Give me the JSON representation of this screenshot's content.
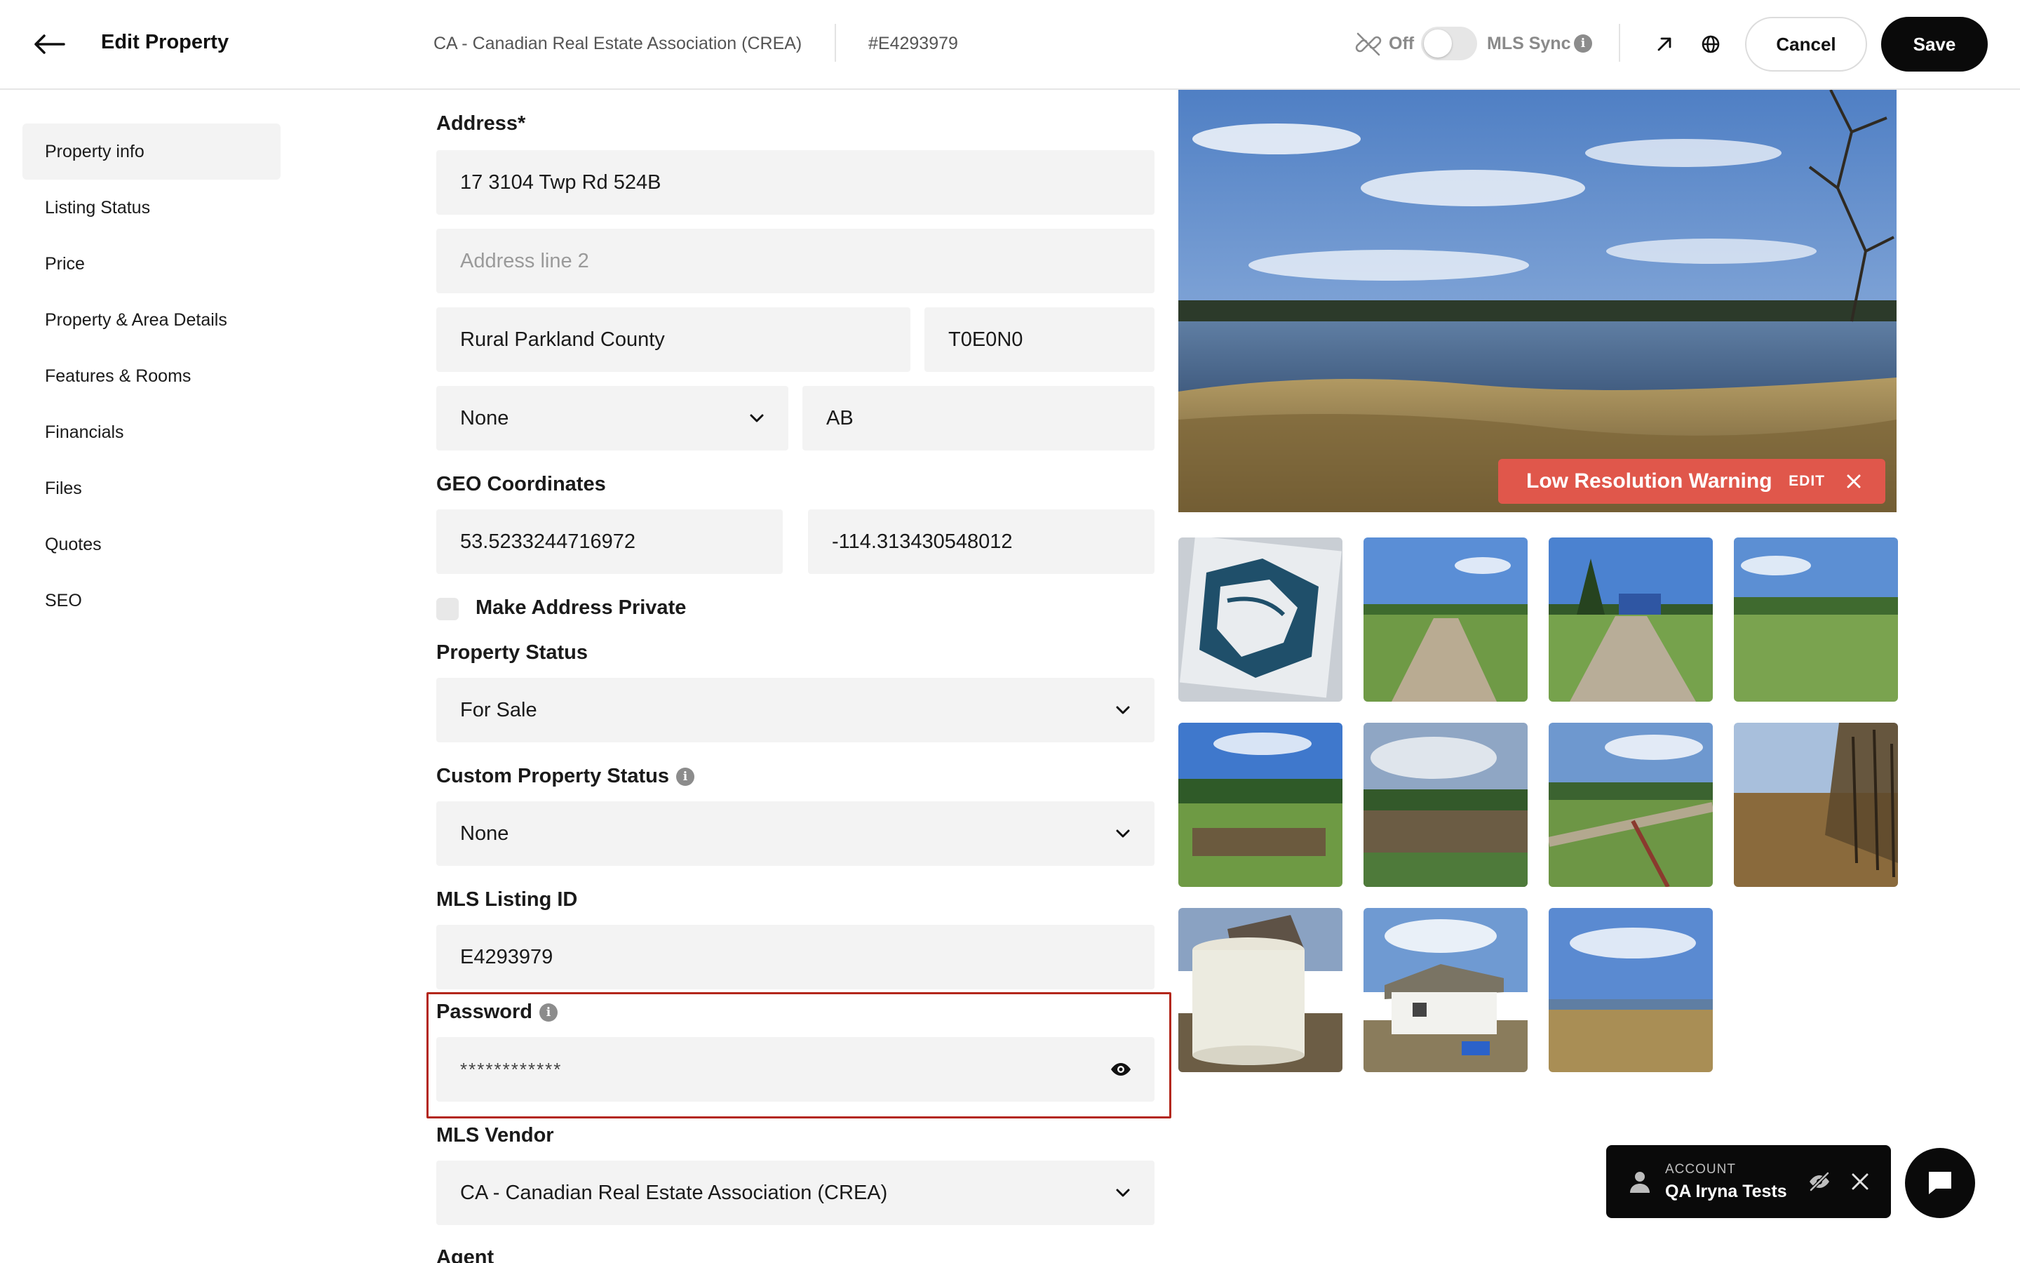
{
  "header": {
    "title": "Edit Property",
    "vendor": "CA - Canadian Real Estate Association (CREA)",
    "listing_number": "#E4293979",
    "sync_state_label": "Off",
    "mls_sync_label": "MLS Sync",
    "info_glyph": "i",
    "cancel_label": "Cancel",
    "save_label": "Save"
  },
  "sidebar": {
    "items": [
      {
        "label": "Property info",
        "active": true
      },
      {
        "label": "Listing Status"
      },
      {
        "label": "Price"
      },
      {
        "label": "Property & Area Details"
      },
      {
        "label": "Features & Rooms"
      },
      {
        "label": "Financials"
      },
      {
        "label": "Files"
      },
      {
        "label": "Quotes"
      },
      {
        "label": "SEO"
      }
    ]
  },
  "form": {
    "address_label": "Address*",
    "address_line1": "17 3104 Twp Rd 524B",
    "address_line2_placeholder": "Address line 2",
    "city": "Rural Parkland County",
    "postal_code": "T0E0N0",
    "region_select": "None",
    "province": "AB",
    "geo_label": "GEO Coordinates",
    "latitude": "53.5233244716972",
    "longitude": "-114.313430548012",
    "private_label": "Make Address Private",
    "property_status_label": "Property Status",
    "property_status": "For Sale",
    "custom_status_label": "Custom Property Status",
    "custom_status": "None",
    "mls_id_label": "MLS Listing ID",
    "mls_id": "E4293979",
    "password_label": "Password",
    "password_value": "************",
    "mls_vendor_label": "MLS Vendor",
    "mls_vendor": "CA - Canadian Real Estate Association (CREA)",
    "agent_label": "Agent"
  },
  "gallery": {
    "warning_text": "Low Resolution Warning",
    "warning_edit": "EDIT",
    "thumbnail_count": 11
  },
  "account": {
    "caption": "ACCOUNT",
    "name": "QA Iryna Tests"
  },
  "colors": {
    "accent": "#0a0a0a",
    "warning": "#e0574b",
    "highlight_border": "#b3271b",
    "field_bg": "#f3f3f3"
  },
  "icons": [
    "back-arrow-icon",
    "sync-off-icon",
    "info-icon",
    "external-link-icon",
    "globe-icon",
    "chevron-down-icon",
    "eye-icon",
    "close-icon",
    "person-icon",
    "eye-slash-icon",
    "chat-icon"
  ]
}
